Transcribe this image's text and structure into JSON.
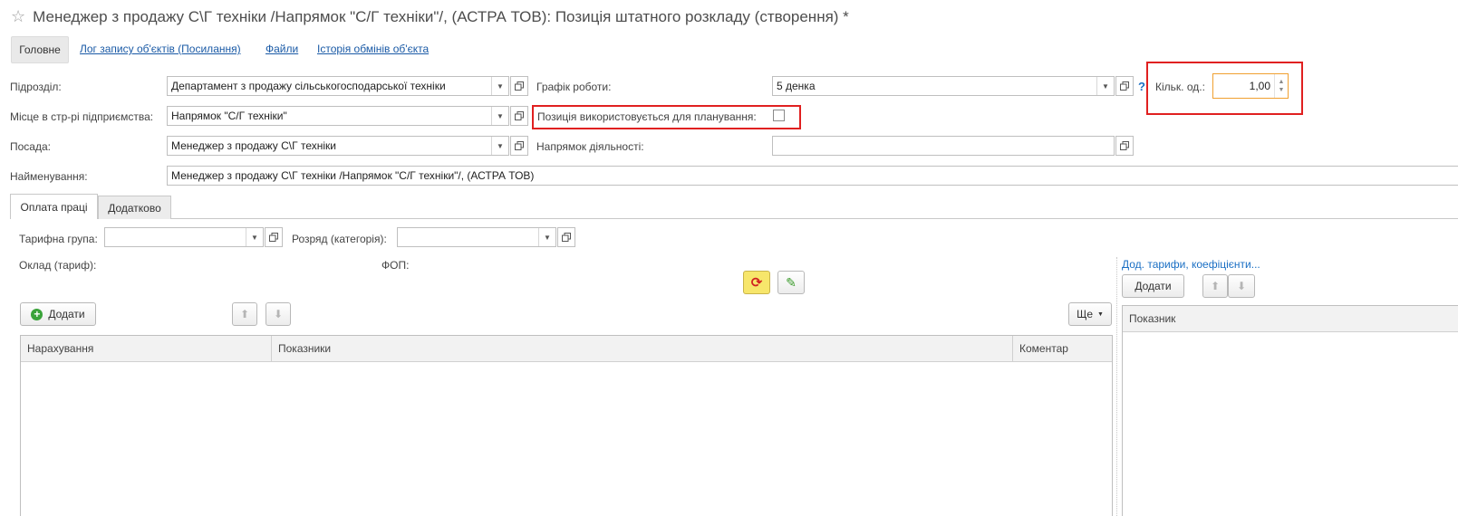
{
  "window": {
    "title": "Менеджер з продажу С\\Г техніки /Напрямок \"С/Г техніки\"/, (АСТРА ТОВ): Позиція штатного розкладу (створення) *"
  },
  "nav": {
    "main": "Головне",
    "links": [
      "Лог запису об'єктів (Посилання)",
      "Файли",
      "Історія обмінів об'єкта"
    ]
  },
  "form": {
    "subdivision": {
      "label": "Підрозділ:",
      "value": "Департамент з  продажу сільськогосподарської техніки"
    },
    "location": {
      "label": "Місце в стр-рі підприємства:",
      "value": "Напрямок \"С/Г техніки\""
    },
    "position": {
      "label": "Посада:",
      "value": "Менеджер з продажу С\\Г техніки"
    },
    "name": {
      "label": "Найменування:",
      "value": "Менеджер з продажу С\\Г техніки /Напрямок \"С/Г техніки\"/, (АСТРА ТОВ)"
    },
    "schedule": {
      "label": "Графік роботи:",
      "value": "5 денка",
      "help": "?"
    },
    "planning": {
      "label": "Позиція використовується для планування:",
      "checked": false
    },
    "direction": {
      "label": "Напрямок діяльності:",
      "value": ""
    },
    "units": {
      "label": "Кільк. од.:",
      "value": "1,00"
    }
  },
  "tabs": [
    "Оплата праці",
    "Додатково"
  ],
  "pay": {
    "tariff_group": {
      "label": "Тарифна група:",
      "value": ""
    },
    "rank": {
      "label": "Розряд (категорія):",
      "value": ""
    },
    "salary_label": "Оклад (тариф):",
    "fop_label": "ФОП:",
    "add_button": "Додати",
    "more_button": "Ще",
    "columns": [
      "Нарахування",
      "Показники",
      "Коментар"
    ]
  },
  "side": {
    "link": "Дод. тарифи, коефіцієнти...",
    "add_button": "Додати",
    "columns": [
      "Показник"
    ]
  },
  "colors": {
    "highlight": "#e02020",
    "link": "#1a5aa6",
    "units_border": "#f0a030",
    "refresh_bg": "#f7e66b"
  }
}
